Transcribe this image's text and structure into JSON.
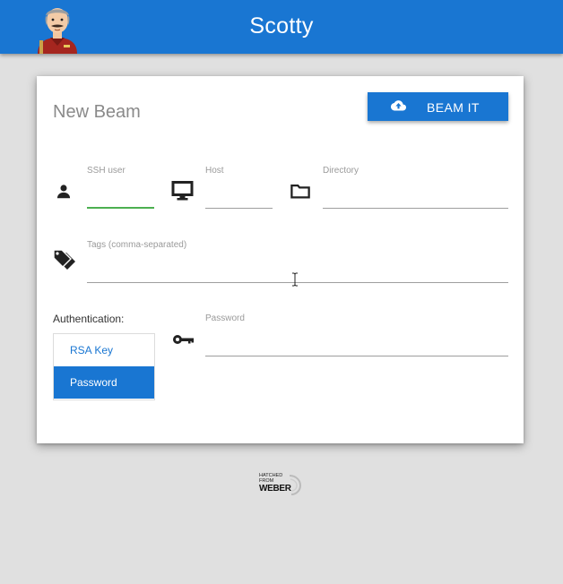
{
  "app": {
    "title": "Scotty",
    "avatar_icon": "scotty-avatar",
    "brand_color": "#1976d2",
    "accent_color": "#4caf50"
  },
  "card": {
    "title": "New Beam",
    "beam_button": {
      "label": "BEAM IT",
      "icon": "cloud-upload-icon"
    }
  },
  "fields": {
    "ssh_user": {
      "label": "SSH user",
      "value": "",
      "icon": "person-icon",
      "focused": true
    },
    "host": {
      "label": "Host",
      "value": "",
      "icon": "monitor-icon"
    },
    "directory": {
      "label": "Directory",
      "value": "",
      "icon": "folder-icon"
    },
    "tags": {
      "label": "Tags (comma-separated)",
      "value": "",
      "icon": "tags-icon"
    },
    "password": {
      "label": "Password",
      "value": "",
      "icon": "key-icon"
    }
  },
  "auth": {
    "label": "Authentication:",
    "options": [
      {
        "label": "RSA Key",
        "selected": false
      },
      {
        "label": "Password",
        "selected": true
      }
    ]
  },
  "footer": {
    "line1": "HATCHED",
    "line2": "FROM",
    "line3": "WEBER"
  }
}
